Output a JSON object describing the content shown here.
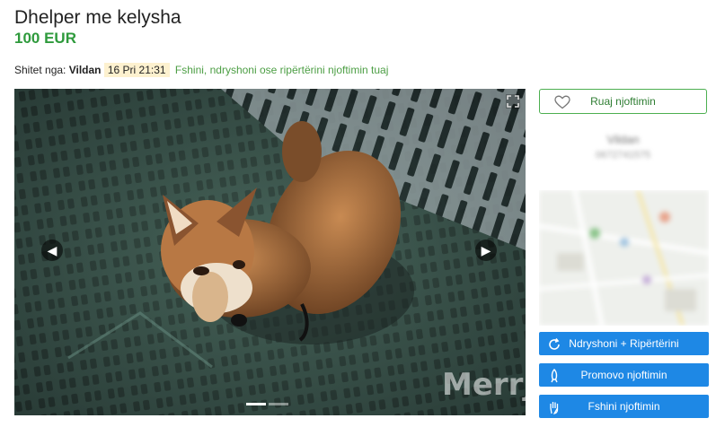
{
  "listing": {
    "title": "Dhelper me kelysha",
    "price": "100 EUR"
  },
  "meta": {
    "seller_prefix": "Shitet nga:",
    "seller_name": "Vildan",
    "date": "16 Pri 21:31",
    "edit_link": "Fshini, ndryshoni ose ripërtërini njoftimin tuaj"
  },
  "gallery": {
    "watermark": "Merrje",
    "prev_icon": "chevron-left-icon",
    "next_icon": "chevron-right-icon",
    "slides": 2,
    "active_slide": 1
  },
  "sidebar": {
    "save_label": "Ruaj njoftimin",
    "seller_name": "Vildan",
    "seller_phone": "0672741575",
    "actions": [
      {
        "label": "Ndryshoni + Ripërtërini",
        "icon": "refresh-icon"
      },
      {
        "label": "Promovo njoftimin",
        "icon": "rocket-icon"
      },
      {
        "label": "Fshini njoftimin",
        "icon": "hand-icon"
      }
    ]
  },
  "colors": {
    "price": "#2e9a3c",
    "primary_button": "#1e88e5",
    "save_border": "#4caf50",
    "date_highlight": "#fdf1cf"
  }
}
